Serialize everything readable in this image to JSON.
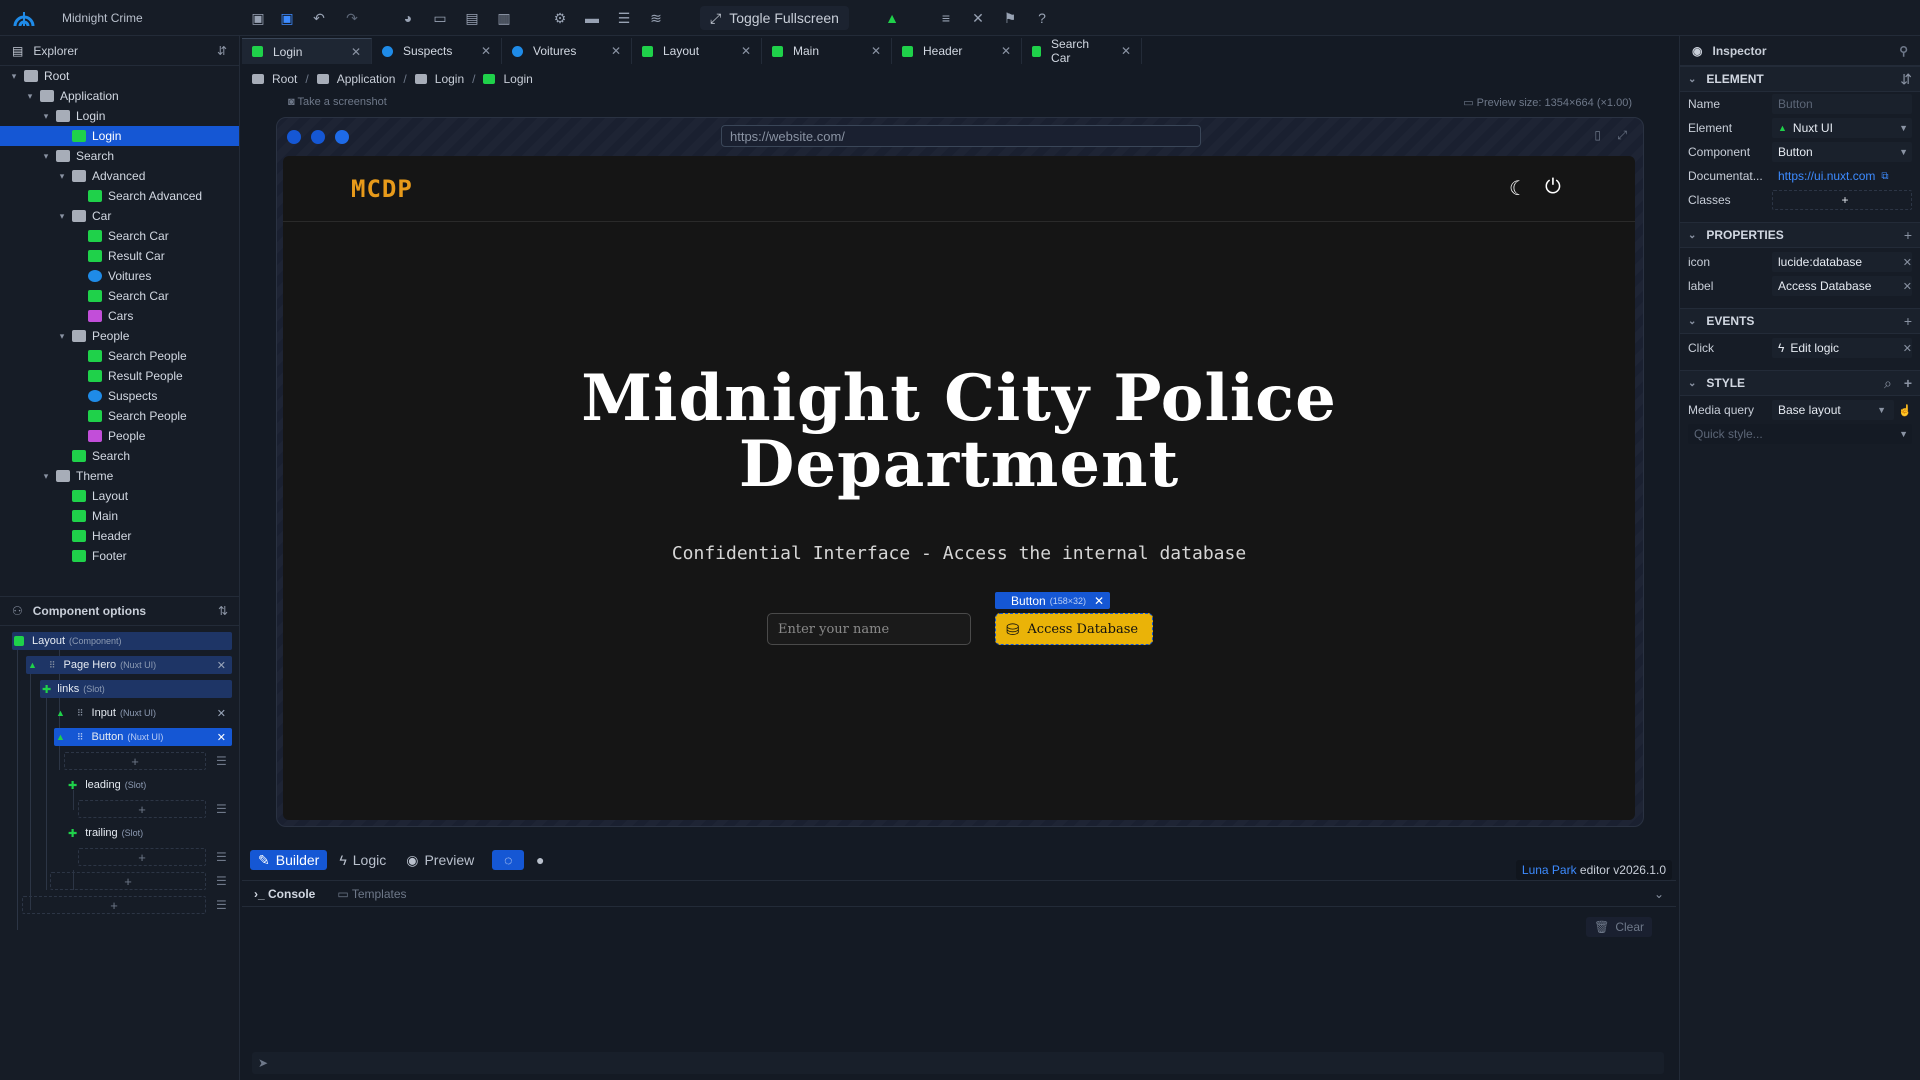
{
  "app": {
    "project_name": "Midnight Crime",
    "fullscreen_label": "Toggle Fullscreen"
  },
  "explorer": {
    "title": "Explorer",
    "tree": [
      {
        "label": "Root",
        "level": 0,
        "icon": "folder",
        "chev": "▾"
      },
      {
        "label": "Application",
        "level": 1,
        "icon": "folder",
        "chev": "▾"
      },
      {
        "label": "Login",
        "level": 2,
        "icon": "folder",
        "chev": "▾"
      },
      {
        "label": "Login",
        "level": 3,
        "icon": "layout",
        "chev": "",
        "selected": true
      },
      {
        "label": "Search",
        "level": 2,
        "icon": "folder",
        "chev": "▾"
      },
      {
        "label": "Advanced",
        "level": 3,
        "icon": "folder",
        "chev": "▾"
      },
      {
        "label": "Search Advanced",
        "level": 4,
        "icon": "page",
        "chev": ""
      },
      {
        "label": "Car",
        "level": 3,
        "icon": "folder",
        "chev": "▾"
      },
      {
        "label": "Search Car",
        "level": 4,
        "icon": "page",
        "chev": ""
      },
      {
        "label": "Result Car",
        "level": 4,
        "icon": "page",
        "chev": ""
      },
      {
        "label": "Voitures",
        "level": 4,
        "icon": "database",
        "chev": ""
      },
      {
        "label": "Search Car",
        "level": 4,
        "icon": "page",
        "chev": ""
      },
      {
        "label": "Cars",
        "level": 4,
        "icon": "component",
        "chev": ""
      },
      {
        "label": "People",
        "level": 3,
        "icon": "folder",
        "chev": "▾"
      },
      {
        "label": "Search People",
        "level": 4,
        "icon": "page",
        "chev": ""
      },
      {
        "label": "Result People",
        "level": 4,
        "icon": "page",
        "chev": ""
      },
      {
        "label": "Suspects",
        "level": 4,
        "icon": "database",
        "chev": ""
      },
      {
        "label": "Search People",
        "level": 4,
        "icon": "page",
        "chev": ""
      },
      {
        "label": "People",
        "level": 4,
        "icon": "component",
        "chev": ""
      },
      {
        "label": "Search",
        "level": 3,
        "icon": "layout",
        "chev": ""
      },
      {
        "label": "Theme",
        "level": 2,
        "icon": "folder",
        "chev": "▾"
      },
      {
        "label": "Layout",
        "level": 3,
        "icon": "page",
        "chev": ""
      },
      {
        "label": "Main",
        "level": 3,
        "icon": "page",
        "chev": ""
      },
      {
        "label": "Header",
        "level": 3,
        "icon": "page",
        "chev": ""
      },
      {
        "label": "Footer",
        "level": 3,
        "icon": "page",
        "chev": ""
      }
    ]
  },
  "component_options": {
    "title": "Component options",
    "layout": {
      "label": "Layout",
      "sub": "(Component)"
    },
    "page_hero": {
      "label": "Page Hero",
      "sub": "(Nuxt UI)"
    },
    "links": {
      "label": "links",
      "sub": "(Slot)"
    },
    "input": {
      "label": "Input",
      "sub": "(Nuxt UI)"
    },
    "button": {
      "label": "Button",
      "sub": "(Nuxt UI)"
    },
    "leading": {
      "label": "leading",
      "sub": "(Slot)"
    },
    "trailing": {
      "label": "trailing",
      "sub": "(Slot)"
    },
    "add": "+"
  },
  "tabs": [
    {
      "label": "Login",
      "icon": "layout",
      "active": true
    },
    {
      "label": "Suspects",
      "icon": "database"
    },
    {
      "label": "Voitures",
      "icon": "database"
    },
    {
      "label": "Layout",
      "icon": "page"
    },
    {
      "label": "Main",
      "icon": "page"
    },
    {
      "label": "Header",
      "icon": "page"
    },
    {
      "label": "Search Car",
      "icon": "page"
    }
  ],
  "breadcrumb": [
    "Root",
    "Application",
    "Login",
    "Login"
  ],
  "toolbar2": {
    "screenshot": "Take a screenshot",
    "preview_size": "Preview size: 1354×664 (×1.00)"
  },
  "preview": {
    "url": "https://website.com/",
    "brand": "MCDP",
    "title": "Midnight City Police Department",
    "subtitle": "Confidential Interface - Access the internal database",
    "input_placeholder": "Enter your name",
    "button_label": "Access Database",
    "selection_tag": {
      "label": "Button",
      "dims": "(158×32)"
    }
  },
  "modes": {
    "builder": "Builder",
    "logic": "Logic",
    "preview": "Preview"
  },
  "version": {
    "brand": "Luna Park",
    "text": " editor v2026.1.0"
  },
  "console": {
    "tab_console": "Console",
    "tab_templates": "Templates",
    "clear": "Clear"
  },
  "inspector": {
    "title": "Inspector",
    "element_section": "ELEMENT",
    "name": {
      "key": "Name",
      "placeholder": "Button"
    },
    "element": {
      "key": "Element",
      "value": "Nuxt UI"
    },
    "component": {
      "key": "Component",
      "value": "Button"
    },
    "documentation": {
      "key": "Documentat...",
      "value": "https://ui.nuxt.com"
    },
    "classes": {
      "key": "Classes",
      "value": "+"
    },
    "properties_section": "PROPERTIES",
    "props": [
      {
        "key": "icon",
        "value": "lucide:database"
      },
      {
        "key": "label",
        "value": "Access Database"
      }
    ],
    "events_section": "EVENTS",
    "click": {
      "key": "Click",
      "value": "Edit logic"
    },
    "style_section": "STYLE",
    "media": {
      "key": "Media query",
      "value": "Base layout"
    },
    "quick_style_placeholder": "Quick style..."
  },
  "colors": {
    "accent": "#1557d4",
    "brand": "#e79a1a",
    "button": "#eab308",
    "page_icon": "#1fd14a",
    "db_icon": "#1f8be8",
    "component_icon": "#c24ed9"
  }
}
